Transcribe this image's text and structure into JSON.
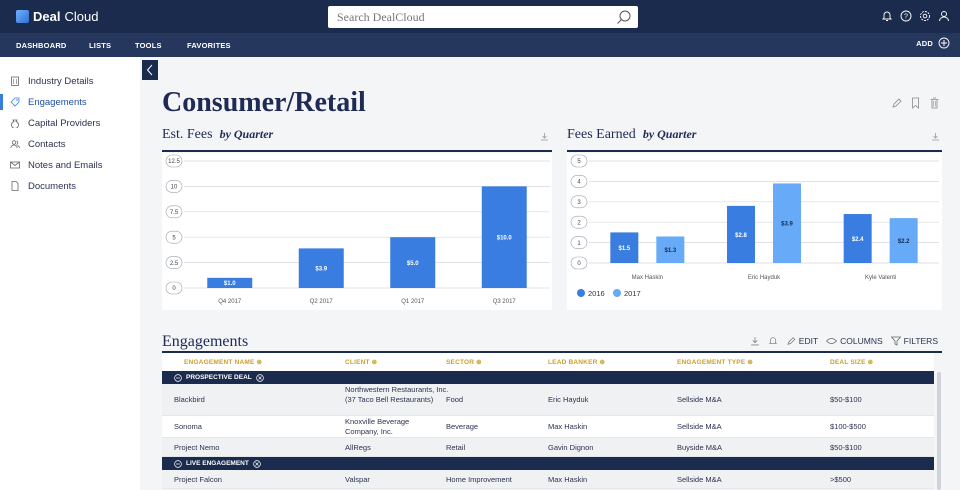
{
  "app": {
    "logo_bold": "Deal",
    "logo_light": "Cloud"
  },
  "search": {
    "placeholder": "Search DealCloud"
  },
  "top_icons": [
    "bell-icon",
    "help-icon",
    "settings-icon",
    "user-icon"
  ],
  "nav": {
    "items": [
      "DASHBOARD",
      "LISTS",
      "TOOLS",
      "FAVORITES"
    ],
    "add_label": "ADD"
  },
  "sidebar": {
    "items": [
      {
        "label": "Industry Details",
        "icon": "building-icon"
      },
      {
        "label": "Engagements",
        "icon": "tag-icon",
        "active": true
      },
      {
        "label": "Capital Providers",
        "icon": "money-bag-icon"
      },
      {
        "label": "Contacts",
        "icon": "people-icon"
      },
      {
        "label": "Notes and Emails",
        "icon": "mail-icon"
      },
      {
        "label": "Documents",
        "icon": "document-icon"
      }
    ]
  },
  "page": {
    "title": "Consumer/Retail"
  },
  "colors": {
    "navy": "#1b2b4d",
    "bar_primary": "#3a7de0",
    "bar_secondary": "#67aaf7",
    "gold": "#c8a12a"
  },
  "chart_data": [
    {
      "type": "bar",
      "title": "Est. Fees",
      "subtitle": "by Quarter",
      "categories": [
        "Q4 2017",
        "Q2 2017",
        "Q1 2017",
        "Q3 2017"
      ],
      "values": [
        1.0,
        3.9,
        5.0,
        10.0
      ],
      "data_labels": [
        "$1.0",
        "$3.9",
        "$5.0",
        "$10.0"
      ],
      "y_ticks": [
        "0",
        "2.5",
        "5",
        "7.5",
        "10",
        "12.5"
      ],
      "ylim": [
        0,
        12.5
      ],
      "grid": true
    },
    {
      "type": "bar",
      "title": "Fees Earned",
      "subtitle": "by Quarter",
      "categories": [
        "Max Haskin",
        "Eric Hayduk",
        "Kyle Valenti"
      ],
      "series": [
        {
          "name": "2016",
          "values": [
            1.5,
            2.8,
            2.4
          ],
          "data_labels": [
            "$1.5",
            "$2.8",
            "$2.4"
          ]
        },
        {
          "name": "2017",
          "values": [
            1.3,
            3.9,
            2.2
          ],
          "data_labels": [
            "$1.3",
            "$3.9",
            "$2.2"
          ]
        }
      ],
      "y_ticks": [
        "0",
        "1",
        "2",
        "3",
        "4",
        "5"
      ],
      "ylim": [
        0,
        5
      ],
      "grid": true,
      "legend": "bottom-left"
    }
  ],
  "engagements": {
    "title": "Engagements",
    "tools": {
      "edit": "EDIT",
      "columns": "COLUMNS",
      "filters": "FILTERS"
    },
    "columns": [
      "ENGAGEMENT NAME",
      "CLIENT",
      "SECTOR",
      "LEAD BANKER",
      "ENGAGEMENT TYPE",
      "DEAL SIZE"
    ],
    "groups": [
      {
        "label": "PROSPECTIVE DEAL",
        "rows": [
          [
            "Blackbird",
            "Northwestern Restaurants, Inc. (37 Taco Bell Restaurants)",
            "Food",
            "Eric Hayduk",
            "Sellside M&A",
            "$50-$100"
          ],
          [
            "Sonoma",
            "Knoxville Beverage Company, Inc.",
            "Beverage",
            "Max Haskin",
            "Sellside M&A",
            "$100-$500"
          ],
          [
            "Project Nemo",
            "AllRegs",
            "Retail",
            "Gavin Dignon",
            "Buyside M&A",
            "$50-$100"
          ]
        ]
      },
      {
        "label": "LIVE ENGAGEMENT",
        "rows": [
          [
            "Project Falcon",
            "Valspar",
            "Home Improvement",
            "Max Haskin",
            "Sellside M&A",
            ">$500"
          ]
        ]
      }
    ]
  }
}
